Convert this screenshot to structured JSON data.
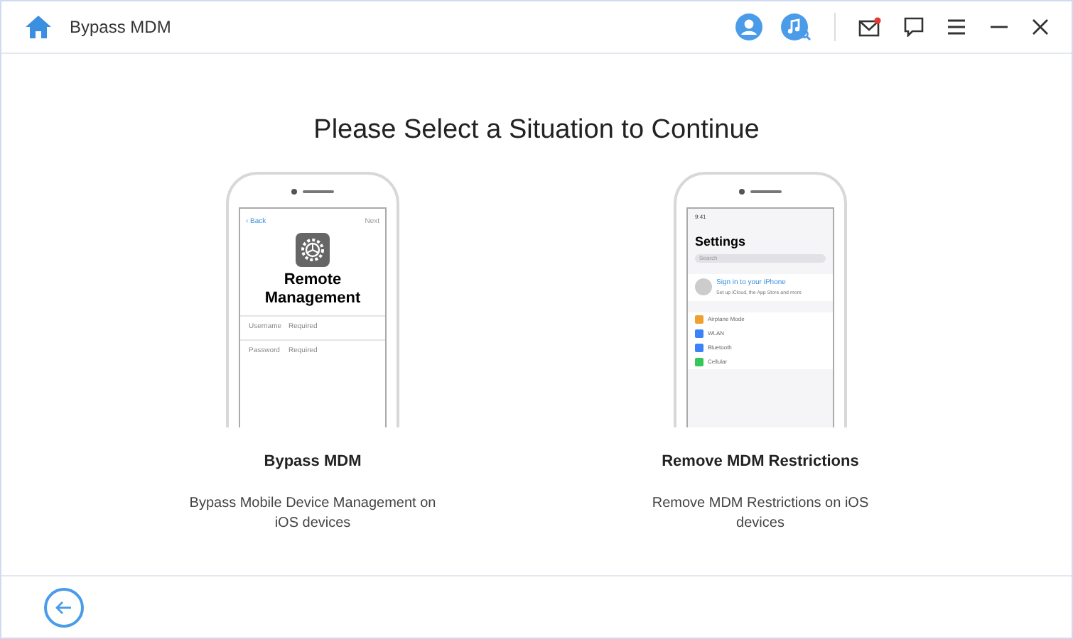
{
  "window": {
    "title": "Bypass MDM"
  },
  "heading": "Please Select a Situation to Continue",
  "options": [
    {
      "kind": "remote",
      "title": "Bypass MDM",
      "description": "Bypass Mobile Device Management on iOS devices",
      "phone": {
        "back": "‹ Back",
        "next": "Next",
        "screen_title": "Remote Management",
        "fields": [
          {
            "label": "Username",
            "placeholder": "Required"
          },
          {
            "label": "Password",
            "placeholder": "Required"
          }
        ]
      }
    },
    {
      "kind": "settings",
      "title": "Remove MDM Restrictions",
      "description": "Remove MDM Restrictions on iOS devices",
      "phone": {
        "time": "9:41",
        "screen_title": "Settings",
        "search": "Search",
        "sign_in": "Sign in to your iPhone",
        "sign_in_sub": "Set up iCloud, the App Store and more",
        "rows": [
          {
            "label": "Airplane Mode",
            "color": "#f0a030"
          },
          {
            "label": "WLAN",
            "color": "#3b82f6"
          },
          {
            "label": "Bluetooth",
            "color": "#3b82f6"
          },
          {
            "label": "Cellular",
            "color": "#34c759"
          }
        ]
      }
    }
  ]
}
